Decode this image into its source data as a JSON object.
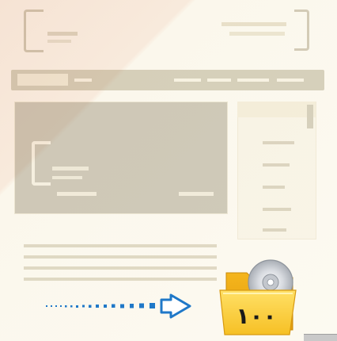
{
  "folder": {
    "number": "١٠٠",
    "icon": "folder-with-disc-icon",
    "folder_color": "#f7c52c",
    "disc_color": "#c9cdd2"
  },
  "arrow": {
    "icon": "dotted-arrow-right-icon",
    "color": "#1f78c8"
  },
  "background": {
    "page_color": "#fbf8ee",
    "nav_color": "#7a6a3a",
    "banner_color": "#5f5230"
  }
}
